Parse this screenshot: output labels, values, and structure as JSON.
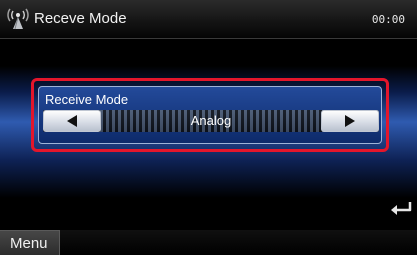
{
  "header": {
    "title": "Receve Mode",
    "clock": "00:00",
    "icon": "antenna-icon"
  },
  "setting": {
    "label": "Receive Mode",
    "value": "Analog",
    "prev_icon": "arrow-left-icon",
    "next_icon": "arrow-right-icon"
  },
  "footer": {
    "menu_label": "Menu",
    "back_icon": "return-arrow-icon"
  },
  "colors": {
    "highlight": "#e3162b",
    "panel": "#234a9a",
    "title_bar": "#1a1a1a"
  }
}
